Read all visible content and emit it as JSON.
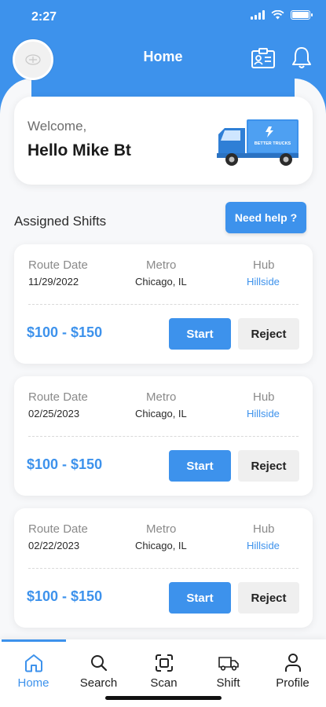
{
  "status_bar": {
    "time": "2:27"
  },
  "header": {
    "title": "Home"
  },
  "welcome": {
    "greeting": "Welcome,",
    "name": "Hello Mike  Bt",
    "truck_brand": "BETTER TRUCKS"
  },
  "shifts_section": {
    "title": "Assigned Shifts",
    "help_label": "Need help ?"
  },
  "columns": {
    "route_date": "Route Date",
    "metro": "Metro",
    "hub": "Hub"
  },
  "shifts": [
    {
      "route_date": "11/29/2022",
      "metro": "Chicago, IL",
      "hub": "Hillside",
      "pay": "$100 - $150",
      "start_label": "Start",
      "reject_label": "Reject"
    },
    {
      "route_date": "02/25/2023",
      "metro": "Chicago, IL",
      "hub": "Hillside",
      "pay": "$100 - $150",
      "start_label": "Start",
      "reject_label": "Reject"
    },
    {
      "route_date": "02/22/2023",
      "metro": "Chicago, IL",
      "hub": "Hillside",
      "pay": "$100 - $150",
      "start_label": "Start",
      "reject_label": "Reject"
    }
  ],
  "nav": [
    {
      "label": "Home",
      "icon": "home-icon",
      "active": true
    },
    {
      "label": "Search",
      "icon": "search-icon",
      "active": false
    },
    {
      "label": "Scan",
      "icon": "scan-icon",
      "active": false
    },
    {
      "label": "Shift",
      "icon": "truck-icon",
      "active": false
    },
    {
      "label": "Profile",
      "icon": "profile-icon",
      "active": false
    }
  ],
  "colors": {
    "accent": "#3d92ec",
    "background": "#f7f8fa",
    "reject_bg": "#efefef"
  }
}
